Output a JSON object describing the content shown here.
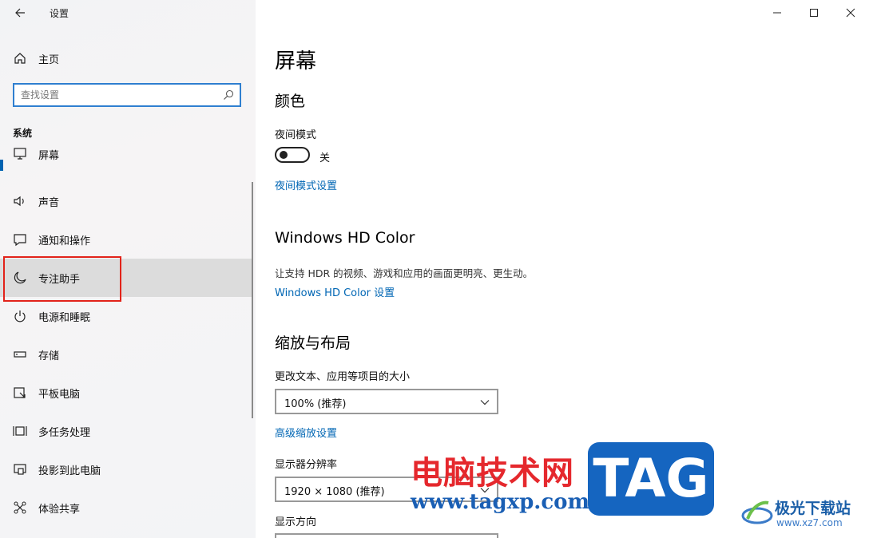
{
  "window": {
    "title": "设置",
    "controls": [
      "minimize-icon",
      "maximize-icon",
      "close-icon"
    ]
  },
  "sidebar": {
    "home_label": "主页",
    "search_placeholder": "查找设置",
    "section_title": "系统",
    "items": [
      {
        "label": "屏幕",
        "icon": "monitor-icon",
        "selected": true
      },
      {
        "label": "声音",
        "icon": "speaker-icon"
      },
      {
        "label": "通知和操作",
        "icon": "notification-icon"
      },
      {
        "label": "专注助手",
        "icon": "moon-icon",
        "hover": true
      },
      {
        "label": "电源和睡眠",
        "icon": "power-icon"
      },
      {
        "label": "存储",
        "icon": "storage-icon"
      },
      {
        "label": "平板电脑",
        "icon": "tablet-icon"
      },
      {
        "label": "多任务处理",
        "icon": "multitask-icon"
      },
      {
        "label": "投影到此电脑",
        "icon": "project-icon"
      },
      {
        "label": "体验共享",
        "icon": "share-icon"
      }
    ]
  },
  "main": {
    "page_title": "屏幕",
    "color_section": "颜色",
    "night_mode_label": "夜间模式",
    "night_mode_state": "关",
    "night_mode_settings_link": "夜间模式设置",
    "hd_color_section": "Windows HD Color",
    "hd_color_desc": "让支持 HDR 的视频、游戏和应用的画面更明亮、更生动。",
    "hd_color_link": "Windows HD Color 设置",
    "scale_section": "缩放与布局",
    "scale_label": "更改文本、应用等项目的大小",
    "scale_value": "100% (推荐)",
    "advanced_scale_link": "高级缩放设置",
    "resolution_label": "显示器分辨率",
    "resolution_value": "1920 × 1080 (推荐)",
    "orientation_label": "显示方向"
  },
  "watermark": {
    "cn_text": "电脑技术网",
    "url": "www.tagxp.com",
    "tag": "TAG",
    "site2_text": "极光下载站",
    "site2_url": "www.xz7.com"
  },
  "colors": {
    "accent": "#0063b1",
    "link": "#0066b4",
    "highlight_box": "#e2231a"
  }
}
